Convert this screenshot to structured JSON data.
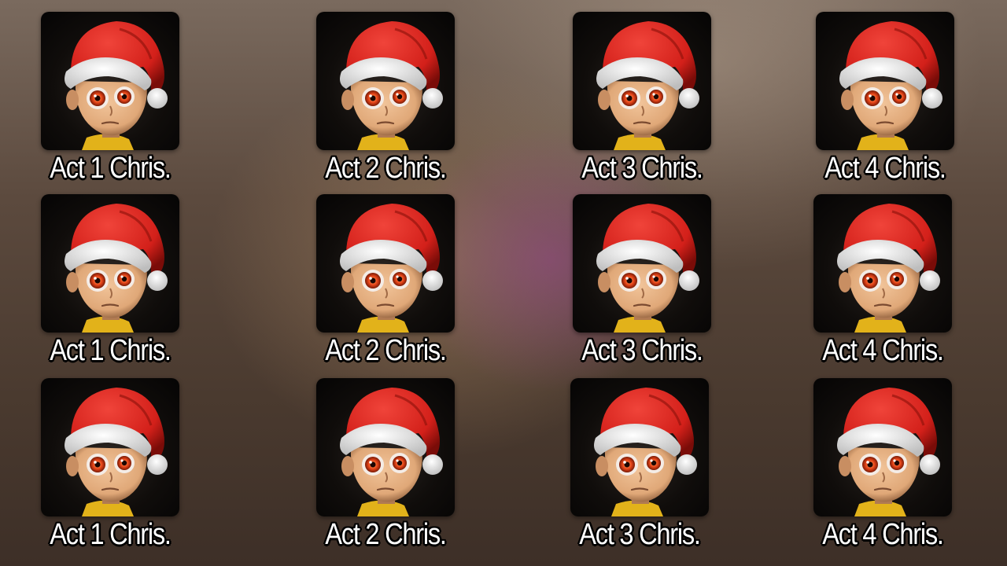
{
  "tiles": [
    {
      "label": "Act 1 Chris.",
      "icon": "santa-hat-baby-face-icon"
    },
    {
      "label": "Act 2 Chris.",
      "icon": "santa-hat-baby-face-icon"
    },
    {
      "label": "Act 3 Chris.",
      "icon": "santa-hat-baby-face-icon"
    },
    {
      "label": "Act 4 Chris.",
      "icon": "santa-hat-baby-face-icon"
    },
    {
      "label": "Act 1 Chris.",
      "icon": "santa-hat-baby-face-icon"
    },
    {
      "label": "Act 2 Chris.",
      "icon": "santa-hat-baby-face-icon"
    },
    {
      "label": "Act 3 Chris.",
      "icon": "santa-hat-baby-face-icon"
    },
    {
      "label": "Act 4 Chris.",
      "icon": "santa-hat-baby-face-icon"
    },
    {
      "label": "Act 1 Chris.",
      "icon": "santa-hat-baby-face-icon"
    },
    {
      "label": "Act 2 Chris.",
      "icon": "santa-hat-baby-face-icon"
    },
    {
      "label": "Act 3 Chris.",
      "icon": "santa-hat-baby-face-icon"
    },
    {
      "label": "Act 4 Chris.",
      "icon": "santa-hat-baby-face-icon"
    }
  ],
  "colors": {
    "hat_red": "#d3201a",
    "hat_trim": "#f2f2f2",
    "skin": "#e0a878",
    "eye_iris": "#e8461a",
    "shirt": "#e2b21a",
    "label_text": "#ffffff",
    "label_outline": "#000000"
  }
}
